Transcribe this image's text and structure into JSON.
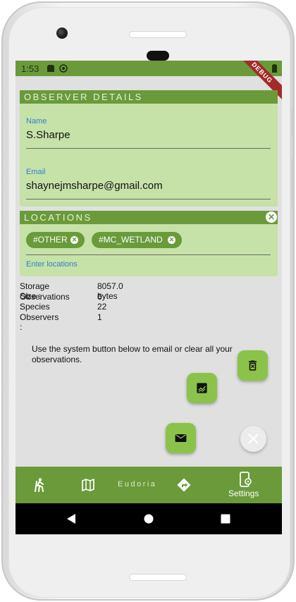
{
  "status_bar": {
    "time": "1:53",
    "debug_label": "DEBUG"
  },
  "observer": {
    "header": "OBSERVER DETAILS",
    "name_label": "Name",
    "name_value": "S.Sharpe",
    "email_label": "Email",
    "email_value": "shaynejmsharpe@gmail.com"
  },
  "locations": {
    "header": "LOCATIONS",
    "chips": [
      {
        "label": "#OTHER"
      },
      {
        "label": "#MC_WETLAND"
      }
    ],
    "input_placeholder": "Enter locations"
  },
  "stats": [
    {
      "key": "Storage Size :",
      "value": "8057.0 bytes"
    },
    {
      "key": "Observations :",
      "value": "6"
    },
    {
      "key": "Species :",
      "value": "22"
    },
    {
      "key": "Observers :",
      "value": "1"
    }
  ],
  "hint_text": "Use the system button below to email or clear all your observations.",
  "fabs": {
    "delete_icon": "delete-icon",
    "chart_icon": "chart-icon",
    "email_icon": "email-icon",
    "close_icon": "close-icon"
  },
  "bottom_nav": {
    "items": [
      {
        "icon": "hiking-icon"
      },
      {
        "icon": "map-icon"
      },
      {
        "title": "Eudoria"
      },
      {
        "icon": "directions-icon"
      },
      {
        "icon": "settings-phone-icon",
        "label": "Settings"
      }
    ]
  },
  "colors": {
    "primary": "#6a9a3a",
    "panel": "#c6e2a8",
    "fab": "#8bc34a",
    "label_blue": "#2f7fd0"
  }
}
